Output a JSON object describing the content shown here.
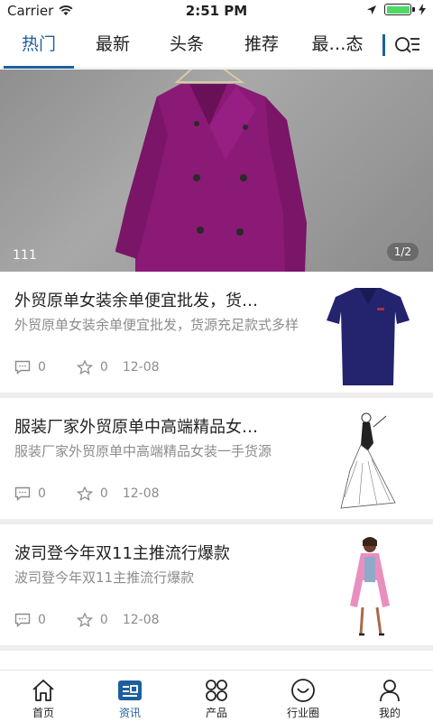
{
  "status_bar": {
    "carrier": "Carrier",
    "time": "2:51 PM",
    "battery_level": 1.0,
    "battery_color": "#4cd964"
  },
  "tabs": [
    {
      "label": "热门",
      "active": true
    },
    {
      "label": "最新",
      "active": false
    },
    {
      "label": "头条",
      "active": false
    },
    {
      "label": "推荐",
      "active": false
    },
    {
      "label": "最…态",
      "active": false
    }
  ],
  "accent_color": "#1d5f9e",
  "banner": {
    "caption": "111",
    "indicator": "1/2",
    "image_subject": "magenta double-breasted coat on hanger"
  },
  "news": [
    {
      "title": "外贸原单女装余单便宜批发，货…",
      "summary": "外贸原单女装余单便宜批发，货源充足款式多样",
      "comments": "0",
      "likes": "0",
      "date": "12-08",
      "thumb_subject": "navy polo shirt"
    },
    {
      "title": "服装厂家外贸原单中高端精品女…",
      "summary": "服装厂家外贸原单中高端精品女装一手货源",
      "comments": "0",
      "likes": "0",
      "date": "12-08",
      "thumb_subject": "fashion sketch of gown"
    },
    {
      "title": "波司登今年双11主推流行爆款",
      "summary": "波司登今年双11主推流行爆款",
      "comments": "0",
      "likes": "0",
      "date": "12-08",
      "thumb_subject": "pink coat model"
    }
  ],
  "bottom_nav": [
    {
      "label": "首页",
      "icon": "home-icon",
      "active": false
    },
    {
      "label": "资讯",
      "icon": "news-icon",
      "active": true
    },
    {
      "label": "产品",
      "icon": "grid-icon",
      "active": false
    },
    {
      "label": "行业圈",
      "icon": "smile-icon",
      "active": false
    },
    {
      "label": "我的",
      "icon": "user-icon",
      "active": false
    }
  ]
}
